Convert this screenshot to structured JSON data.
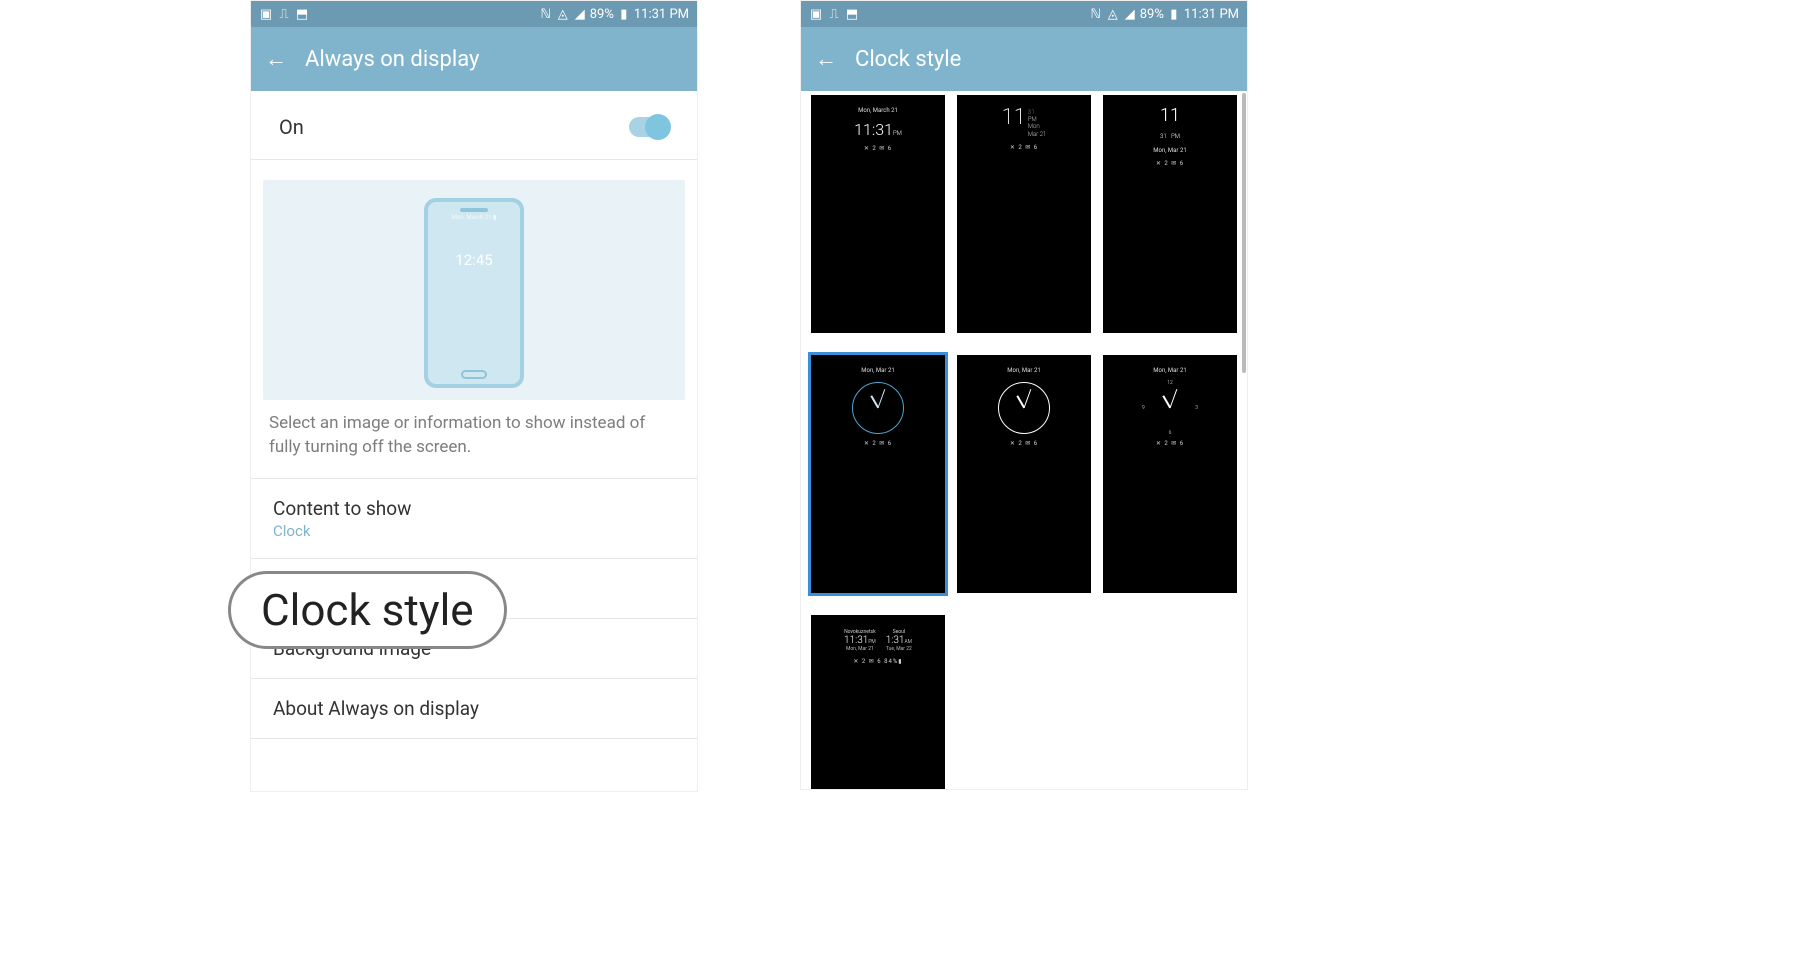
{
  "status": {
    "battery_text": "89%",
    "time": "11:31 PM"
  },
  "left": {
    "title": "Always on display",
    "toggle_label": "On",
    "preview_time": "12:45",
    "description": "Select an image or information to show instead of fully turning off the screen.",
    "content_label": "Content to show",
    "content_value": "Clock",
    "clock_style_label": "Clock style",
    "bg_label": "Background image",
    "about_label": "About Always on display"
  },
  "right": {
    "title": "Clock style",
    "tiles": {
      "date_str": "Mon, Mar 21",
      "date_full": "Mon, March 21",
      "icons_str": "✕ 2    ✉ 6",
      "icons_full": "✕ 2   ✉ 6   84%▮",
      "t1_time": "11:31",
      "t1_ampm": "PM",
      "t2_hour": "11",
      "t2_min": "31",
      "t2_ampm": "PM",
      "t2_day": "Mon",
      "t2_date": "Mar 21",
      "t3_top": "11",
      "t3_bot": "31",
      "t3_ampm": "PM",
      "world_city1": "Novokuznetsk",
      "world_time1": "11:31",
      "world_ampm1": "PM",
      "world_date1": "Mon, Mar 21",
      "world_city2": "Seoul",
      "world_time2": "1:31",
      "world_ampm2": "AM",
      "world_date2": "Tue, Mar 22",
      "face_12": "12",
      "face_3": "3",
      "face_6": "6",
      "face_9": "9"
    }
  },
  "callout": "Clock style"
}
